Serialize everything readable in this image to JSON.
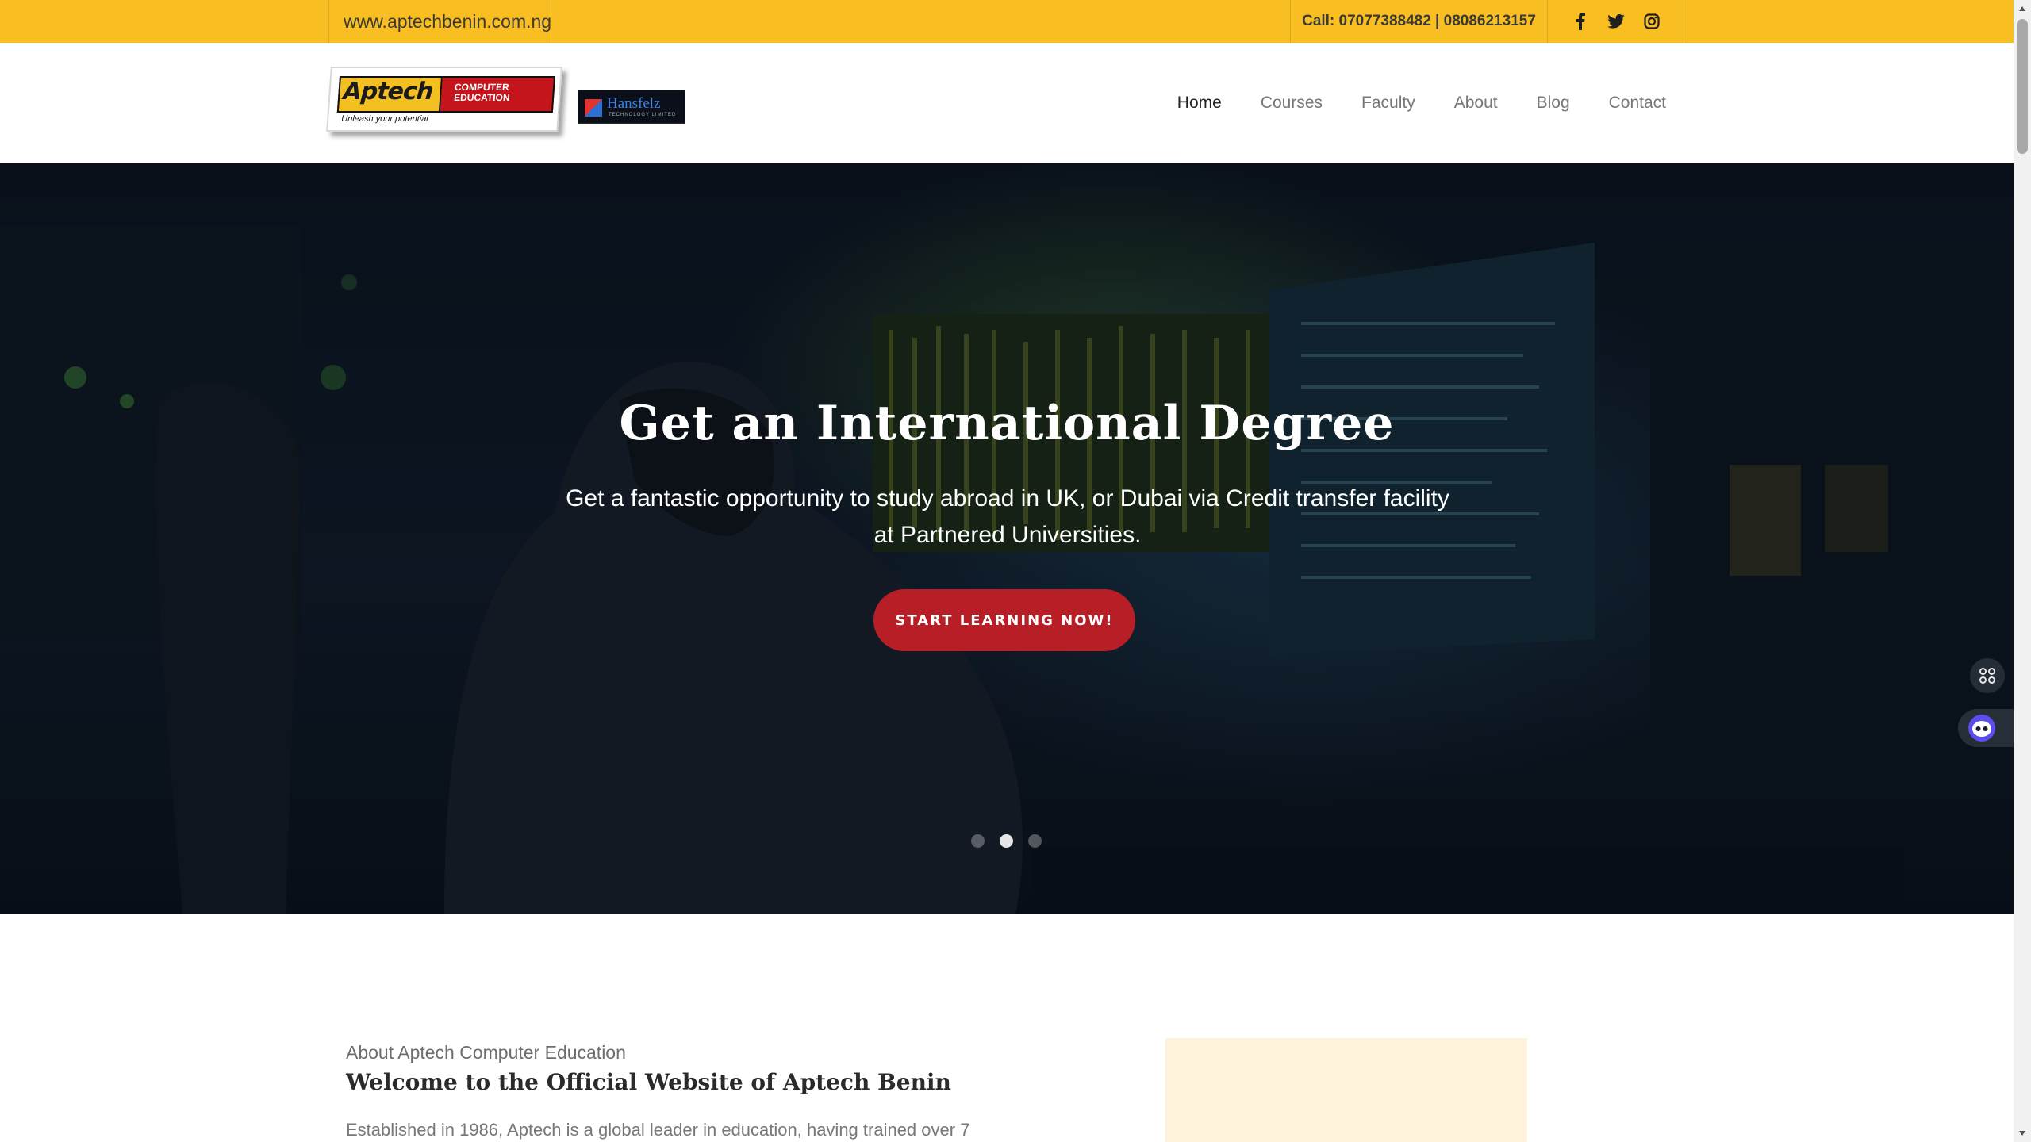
{
  "topbar": {
    "url": "www.aptechbenin.com.ng",
    "call": "Call: 07077388482 | 08086213157",
    "social": [
      "facebook-icon",
      "twitter-icon",
      "instagram-icon"
    ],
    "bg_color": "#f9be21"
  },
  "header": {
    "logo_main": "Aptech",
    "logo_sub_line1": "COMPUTER",
    "logo_sub_line2": "EDUCATION",
    "logo_tagline": "Unleash your potential",
    "logo_partner": "Hansfelz",
    "logo_partner_sub": "TECHNOLOGY LIMITED",
    "nav": [
      "Home",
      "Courses",
      "Faculty",
      "About",
      "Blog",
      "Contact"
    ],
    "active_nav": "Home"
  },
  "hero": {
    "title": "Get an International Degree",
    "subtitle": "Get a fantastic opportunity to study abroad in UK, or Dubai via Credit transfer facility at Partnered Universities.",
    "cta": "START LEARNING NOW!",
    "cta_color": "#b81e26",
    "slide_count": 3,
    "active_slide": 2
  },
  "about": {
    "kicker": "About Aptech Computer Education",
    "title": "Welcome to the Official Website of Aptech Benin",
    "text": "Established in 1986, Aptech is a global leader in education, having trained over 7"
  },
  "widgets": [
    "apps-grid-icon",
    "assistant-icon"
  ]
}
